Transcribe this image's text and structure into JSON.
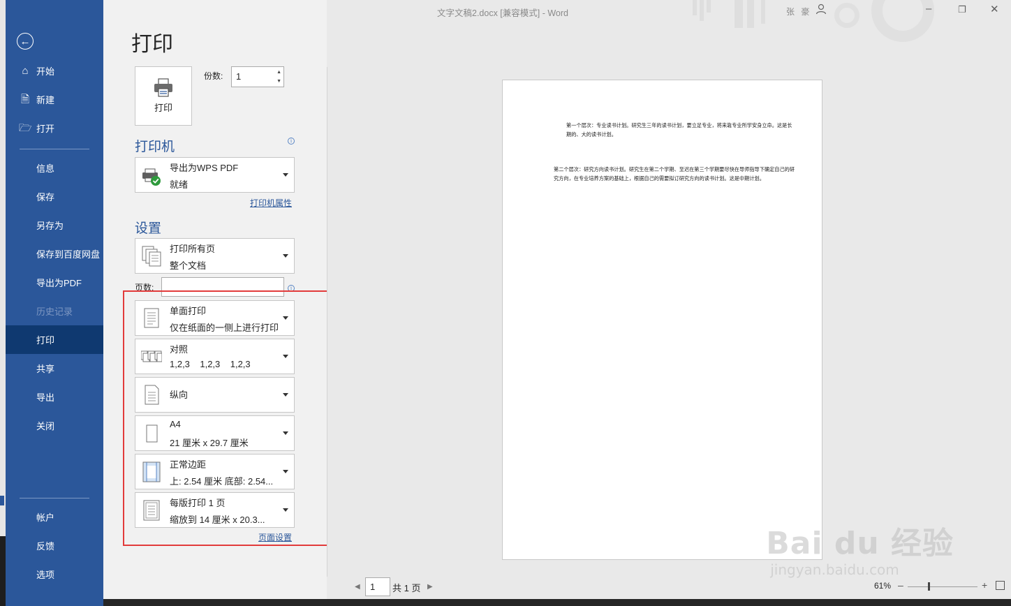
{
  "window": {
    "title": "文字文稿2.docx [兼容模式]  -  Word",
    "user": "张 豪"
  },
  "sidebar": {
    "back_icon": "back-arrow-icon",
    "items": [
      {
        "label": "开始",
        "icon": "home-icon"
      },
      {
        "label": "新建",
        "icon": "new-doc-icon"
      },
      {
        "label": "打开",
        "icon": "folder-open-icon"
      },
      {
        "label": "信息"
      },
      {
        "label": "保存"
      },
      {
        "label": "另存为"
      },
      {
        "label": "保存到百度网盘"
      },
      {
        "label": "导出为PDF"
      },
      {
        "label": "历史记录",
        "disabled": true
      },
      {
        "label": "打印",
        "active": true
      },
      {
        "label": "共享"
      },
      {
        "label": "导出"
      },
      {
        "label": "关闭"
      }
    ],
    "bottom_items": [
      {
        "label": "帐户"
      },
      {
        "label": "反馈"
      },
      {
        "label": "选项"
      }
    ]
  },
  "print": {
    "heading": "打印",
    "print_button_label": "打印",
    "copies_label": "份数:",
    "copies_value": "1",
    "printer_section_title": "打印机",
    "printer": {
      "name": "导出为WPS PDF",
      "status": "就绪"
    },
    "printer_properties_link": "打印机属性",
    "settings_section_title": "设置",
    "pages_label": "页数:",
    "pages_value": "",
    "page_setup_link": "页面设置",
    "settings": [
      {
        "line1": "打印所有页",
        "line2": "整个文档",
        "icon": "pages-icon"
      },
      {
        "line1": "单面打印",
        "line2": "仅在纸面的一侧上进行打印",
        "icon": "one-sided-icon"
      },
      {
        "line1": "对照",
        "line2": "1,2,3    1,2,3    1,2,3",
        "icon": "collate-icon"
      },
      {
        "line1": "纵向",
        "line2": "",
        "icon": "portrait-icon"
      },
      {
        "line1": "A4",
        "line2": "21 厘米 x 29.7 厘米",
        "icon": "paper-size-icon"
      },
      {
        "line1": "正常边距",
        "line2": "上: 2.54 厘米 底部: 2.54...",
        "icon": "margins-icon"
      },
      {
        "line1": "每版打印 1 页",
        "line2": "缩放到 14 厘米 x 20.3...",
        "icon": "pages-per-sheet-icon"
      }
    ]
  },
  "preview": {
    "para1": "第一个层次：专业读书计划。研究生三年的读书计划，要立足专业，将来靠专业所学安身立命。这是长期的、大的读书计划。",
    "para2": "第二个层次：研究方向读书计划。研究生在第二个学期、至迟在第三个学期要尽快在导师指导下确定自己的研究方向，在专业培养方案的基础上，根据自己的需要拟订研究方向的读书计划。这是中期计划。",
    "page_current": "1",
    "page_total": "共 1 页",
    "zoom": "61%",
    "zoom_level_percent": 61
  },
  "watermark": {
    "big": "Bai du 经验",
    "small": "jingyan.baidu.com"
  },
  "colors": {
    "sidebar": "#2b579a",
    "sidebar_active": "#0f3970",
    "highlight_box": "#e23b3b",
    "link": "#2b579a"
  }
}
